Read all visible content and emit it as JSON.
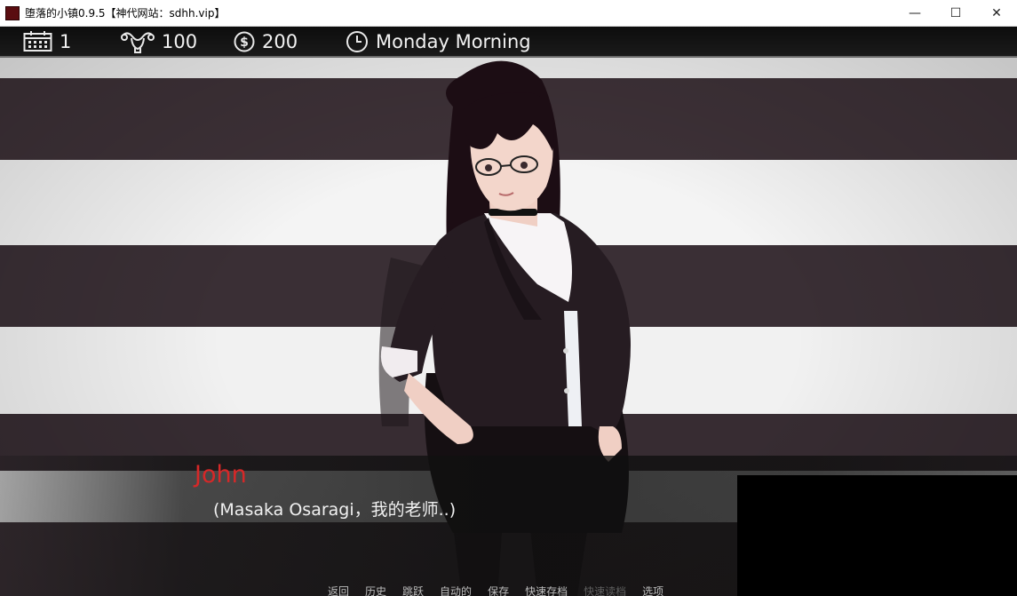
{
  "window": {
    "title": "堕落的小镇0.9.5【神代网站：sdhh.vip】",
    "minimize_glyph": "—",
    "maximize_glyph": "☐",
    "close_glyph": "✕"
  },
  "hud": {
    "day_icon": "calendar-icon",
    "day": "1",
    "libido_icon": "womb-icon",
    "libido": "100",
    "money_icon": "dollar-coin-icon",
    "money": "200",
    "time_icon": "clock-icon",
    "time": "Monday Morning"
  },
  "colors": {
    "speaker_name": "#d62828",
    "hud_background": "#111111",
    "stripe_dark": "#3d3137",
    "stripe_light": "#f0f0f0"
  },
  "dialogue": {
    "speaker": "John",
    "text": "(Masaka Osaragi，我的老师..)"
  },
  "quick_menu": [
    {
      "label": "返回",
      "enabled": true
    },
    {
      "label": "历史",
      "enabled": true
    },
    {
      "label": "跳跃",
      "enabled": true
    },
    {
      "label": "自动的",
      "enabled": true
    },
    {
      "label": "保存",
      "enabled": true
    },
    {
      "label": "快速存档",
      "enabled": true
    },
    {
      "label": "快速读档",
      "enabled": false
    },
    {
      "label": "选项",
      "enabled": true
    }
  ]
}
